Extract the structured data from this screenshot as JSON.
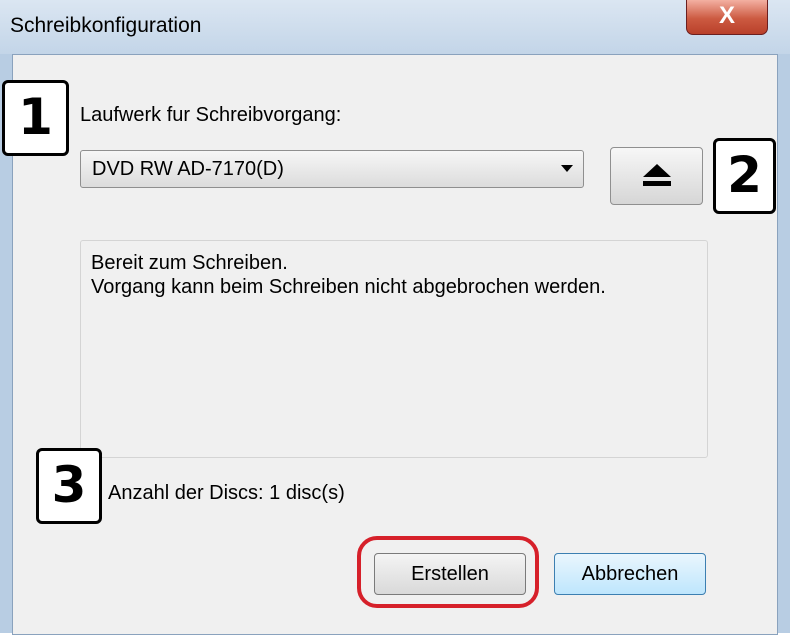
{
  "window": {
    "title": "Schreibkonfiguration",
    "close_label": "X"
  },
  "annotations": {
    "badge1": "1",
    "badge2": "2",
    "badge3": "3"
  },
  "drive": {
    "label": "Laufwerk fur Schreibvorgang:",
    "selected": "DVD RW AD-7170(D)",
    "eject_icon": "eject-icon"
  },
  "status": {
    "line1": "Bereit zum Schreiben.",
    "line2": "Vorgang kann beim Schreiben nicht abgebrochen werden."
  },
  "disc_count": "Anzahl der Discs: 1 disc(s)",
  "buttons": {
    "create": "Erstellen",
    "cancel": "Abbrechen"
  },
  "colors": {
    "highlight_ring": "#d6202a",
    "close_button": "#cc5a41"
  }
}
